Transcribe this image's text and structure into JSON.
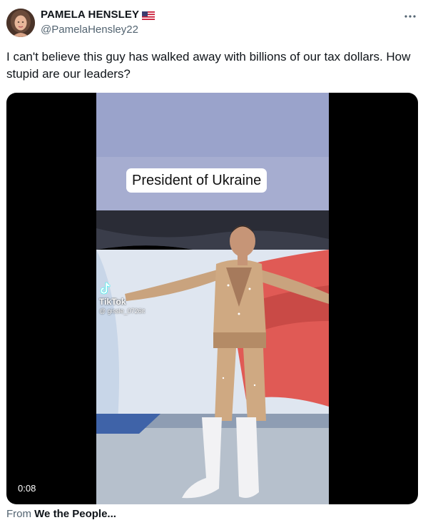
{
  "author": {
    "display_name": "PAMELA HENSLEY",
    "handle": "@PamelaHensley22",
    "flag_icon": "us-flag-icon"
  },
  "menu": {
    "icon": "more-horizontal-icon"
  },
  "tweet": {
    "text": "I can't believe this guy has walked away with billions of our tax dollars. How stupid are our leaders?"
  },
  "media": {
    "caption": "President of Ukraine",
    "watermark_brand": "TikTok",
    "watermark_user": "@ gissle_0726it",
    "duration": "0:08"
  },
  "source": {
    "prefix": "From",
    "name": "We the People..."
  },
  "colors": {
    "secondary_text": "#536471",
    "primary_text": "#0f1419",
    "media_bg": "#000000"
  }
}
